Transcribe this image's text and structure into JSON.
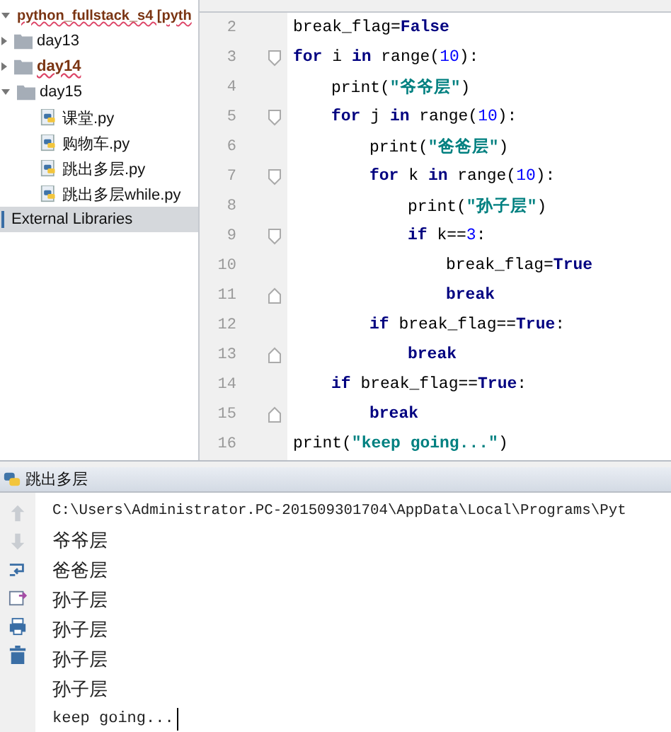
{
  "project_tree": {
    "root": {
      "label": "python_fullstack_s4 [pyth",
      "highlighted": true,
      "expanded": true
    },
    "children": [
      {
        "label": "day13",
        "kind": "folder",
        "highlighted": false,
        "expanded": false
      },
      {
        "label": "day14",
        "kind": "folder",
        "highlighted": true,
        "expanded": false
      },
      {
        "label": "day15",
        "kind": "folder",
        "highlighted": false,
        "expanded": true,
        "children": [
          {
            "label": "课堂.py",
            "kind": "file",
            "highlighted": false
          },
          {
            "label": "购物车.py",
            "kind": "file",
            "highlighted": false
          },
          {
            "label": "跳出多层.py",
            "kind": "file",
            "highlighted": false
          },
          {
            "label": "跳出多层while.py",
            "kind": "file",
            "highlighted": false
          }
        ]
      }
    ],
    "libraries": {
      "label": "External Libraries",
      "selected": true
    }
  },
  "editor": {
    "lines": [
      {
        "number": "2",
        "tokens": [
          {
            "kind": "plain",
            "text": "break_flag="
          },
          {
            "kind": "const",
            "text": "False"
          }
        ]
      },
      {
        "number": "3",
        "fold_start": true,
        "tokens": [
          {
            "kind": "kw",
            "text": "for"
          },
          {
            "kind": "plain",
            "text": " i "
          },
          {
            "kind": "kw",
            "text": "in"
          },
          {
            "kind": "plain",
            "text": " range("
          },
          {
            "kind": "num",
            "text": "10"
          },
          {
            "kind": "plain",
            "text": "):"
          }
        ],
        "children": [
          {
            "number": "4",
            "tokens": [
              {
                "kind": "plain",
                "text": "print("
              },
              {
                "kind": "str",
                "text": "\"爷爷层\""
              },
              {
                "kind": "plain",
                "text": ")"
              }
            ]
          },
          {
            "number": "5",
            "fold_start": true,
            "tokens": [
              {
                "kind": "kw",
                "text": "for"
              },
              {
                "kind": "plain",
                "text": " j "
              },
              {
                "kind": "kw",
                "text": "in"
              },
              {
                "kind": "plain",
                "text": " range("
              },
              {
                "kind": "num",
                "text": "10"
              },
              {
                "kind": "plain",
                "text": "):"
              }
            ],
            "children": [
              {
                "number": "6",
                "tokens": [
                  {
                    "kind": "plain",
                    "text": "print("
                  },
                  {
                    "kind": "str",
                    "text": "\"爸爸层\""
                  },
                  {
                    "kind": "plain",
                    "text": ")"
                  }
                ]
              },
              {
                "number": "7",
                "fold_start": true,
                "tokens": [
                  {
                    "kind": "kw",
                    "text": "for"
                  },
                  {
                    "kind": "plain",
                    "text": " k "
                  },
                  {
                    "kind": "kw",
                    "text": "in"
                  },
                  {
                    "kind": "plain",
                    "text": " range("
                  },
                  {
                    "kind": "num",
                    "text": "10"
                  },
                  {
                    "kind": "plain",
                    "text": "):"
                  }
                ],
                "children": [
                  {
                    "number": "8",
                    "tokens": [
                      {
                        "kind": "plain",
                        "text": "print("
                      },
                      {
                        "kind": "str",
                        "text": "\"孙子层\""
                      },
                      {
                        "kind": "plain",
                        "text": ")"
                      }
                    ]
                  },
                  {
                    "number": "9",
                    "fold_start": true,
                    "tokens": [
                      {
                        "kind": "kw",
                        "text": "if"
                      },
                      {
                        "kind": "plain",
                        "text": " k=="
                      },
                      {
                        "kind": "num",
                        "text": "3"
                      },
                      {
                        "kind": "plain",
                        "text": ":"
                      }
                    ],
                    "children": [
                      {
                        "number": "10",
                        "tokens": [
                          {
                            "kind": "plain",
                            "text": "break_flag="
                          },
                          {
                            "kind": "const",
                            "text": "True"
                          }
                        ]
                      },
                      {
                        "number": "11",
                        "fold_end": true,
                        "tokens": [
                          {
                            "kind": "kw",
                            "text": "break"
                          }
                        ]
                      }
                    ]
                  }
                ]
              },
              {
                "number": "12",
                "tokens": [
                  {
                    "kind": "kw",
                    "text": "if"
                  },
                  {
                    "kind": "plain",
                    "text": " break_flag=="
                  },
                  {
                    "kind": "const",
                    "text": "True"
                  },
                  {
                    "kind": "plain",
                    "text": ":"
                  }
                ],
                "children": [
                  {
                    "number": "13",
                    "fold_end": true,
                    "tokens": [
                      {
                        "kind": "kw",
                        "text": "break"
                      }
                    ]
                  }
                ]
              }
            ]
          },
          {
            "number": "14",
            "tokens": [
              {
                "kind": "kw",
                "text": "if"
              },
              {
                "kind": "plain",
                "text": " break_flag=="
              },
              {
                "kind": "const",
                "text": "True"
              },
              {
                "kind": "plain",
                "text": ":"
              }
            ],
            "children": [
              {
                "number": "15",
                "fold_end": true,
                "tokens": [
                  {
                    "kind": "kw",
                    "text": "break"
                  }
                ]
              }
            ]
          }
        ]
      },
      {
        "number": "16",
        "tokens": [
          {
            "kind": "plain",
            "text": "print("
          },
          {
            "kind": "str",
            "text": "\"keep going...\""
          },
          {
            "kind": "plain",
            "text": ")"
          }
        ]
      }
    ]
  },
  "run_panel": {
    "title": "跳出多层",
    "toolbar": [
      {
        "kind": "up",
        "disabled": true
      },
      {
        "kind": "down",
        "disabled": true
      },
      {
        "kind": "wrap",
        "disabled": false
      },
      {
        "kind": "export",
        "disabled": false
      },
      {
        "kind": "print",
        "disabled": false
      },
      {
        "kind": "trash",
        "disabled": false
      }
    ],
    "output": [
      {
        "kind": "path",
        "text": "C:\\Users\\Administrator.PC-201509301704\\AppData\\Local\\Programs\\Pyt"
      },
      {
        "kind": "cjk",
        "text": "爷爷层"
      },
      {
        "kind": "cjk",
        "text": "爸爸层"
      },
      {
        "kind": "cjk",
        "text": "孙子层"
      },
      {
        "kind": "cjk",
        "text": "孙子层"
      },
      {
        "kind": "cjk",
        "text": "孙子层"
      },
      {
        "kind": "cjk",
        "text": "孙子层"
      },
      {
        "kind": "mono",
        "text": "keep going...",
        "cursor": true
      }
    ]
  }
}
